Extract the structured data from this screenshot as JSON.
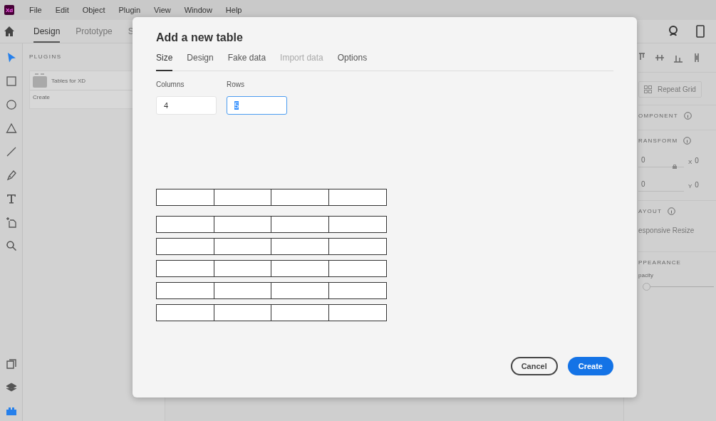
{
  "app": {
    "logo": "Xd",
    "menu": [
      "File",
      "Edit",
      "Object",
      "Plugin",
      "View",
      "Window",
      "Help"
    ],
    "mode_tabs": [
      {
        "label": "Design",
        "selected": true
      },
      {
        "label": "Prototype",
        "selected": false
      },
      {
        "label": "S",
        "selected": false
      }
    ],
    "tools": [
      {
        "kind": "select",
        "selected": true
      },
      {
        "kind": "rectangle",
        "selected": false
      },
      {
        "kind": "ellipse",
        "selected": false
      },
      {
        "kind": "triangle",
        "selected": false
      },
      {
        "kind": "line",
        "selected": false
      },
      {
        "kind": "pen",
        "selected": false
      },
      {
        "kind": "text",
        "selected": false
      },
      {
        "kind": "artboard",
        "selected": false
      },
      {
        "kind": "zoom",
        "selected": false
      }
    ],
    "bottom_tools": [
      {
        "kind": "assets",
        "selected": false
      },
      {
        "kind": "layers",
        "selected": false
      },
      {
        "kind": "plugins",
        "selected": true
      }
    ]
  },
  "plugins_panel": {
    "heading": "PLUGINS",
    "plugin": {
      "name": "Tables for XD",
      "command": "Create"
    }
  },
  "right_panel": {
    "repeat_grid": "Repeat Grid",
    "component": {
      "title": "OMPONENT"
    },
    "transform": {
      "title": "RANSFORM",
      "rows": [
        {
          "value_1": "0",
          "axis": "X",
          "value_2": "0"
        },
        {
          "value_1": "0",
          "axis": "Y",
          "value_2": "0"
        }
      ]
    },
    "layout": {
      "title": "AYOUT",
      "option": "esponsive Resize"
    },
    "appearance": {
      "title": "PPEARANCE",
      "opacity_label": "pacity",
      "opacity": {
        "level": 0
      }
    }
  },
  "dialog": {
    "title": "Add a new table",
    "tabs": [
      {
        "label": "Size",
        "selected": true,
        "disabled": false
      },
      {
        "label": "Design",
        "selected": false,
        "disabled": false
      },
      {
        "label": "Fake data",
        "selected": false,
        "disabled": false
      },
      {
        "label": "Import data",
        "selected": false,
        "disabled": true
      },
      {
        "label": "Options",
        "selected": false,
        "disabled": false
      }
    ],
    "columns": {
      "label": "Columns",
      "value": "4",
      "focused": false
    },
    "rows": {
      "label": "Rows",
      "value": "5",
      "focused": true
    },
    "buttons": [
      {
        "label": "Cancel",
        "kind": "secondary"
      },
      {
        "label": "Create",
        "kind": "primary"
      }
    ]
  }
}
